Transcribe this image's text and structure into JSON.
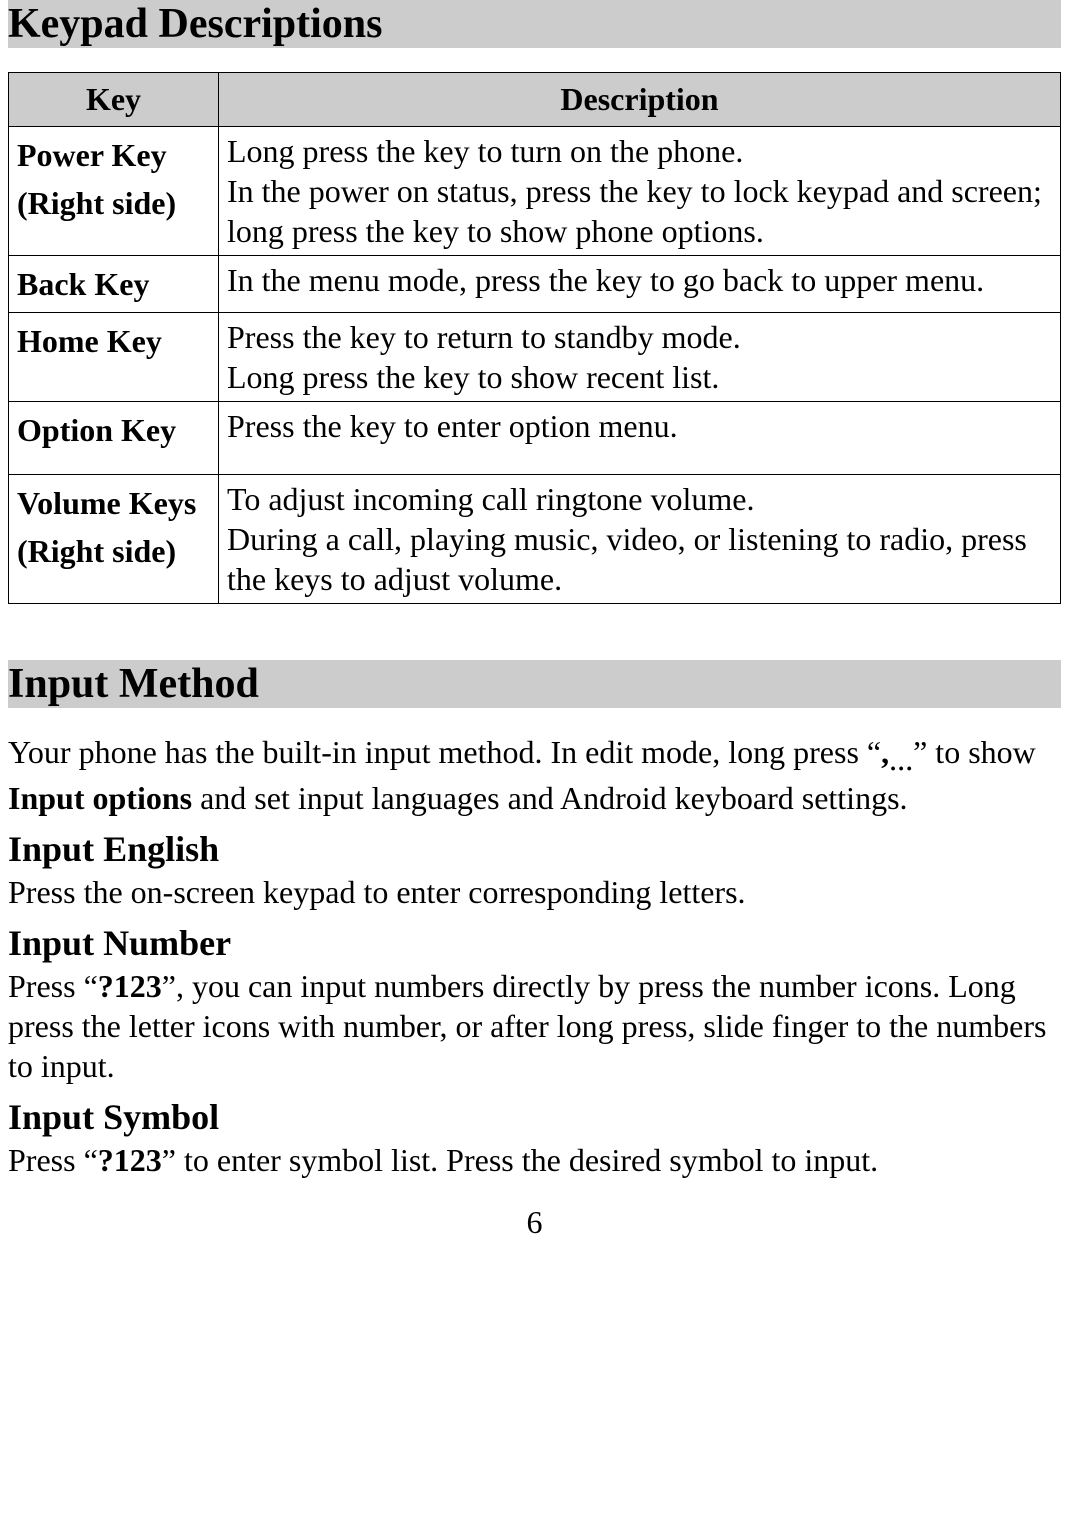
{
  "headings": {
    "keypad_descriptions": "Keypad Descriptions",
    "input_method": "Input Method",
    "input_english": "Input English",
    "input_number": "Input Number",
    "input_symbol": "Input Symbol"
  },
  "table": {
    "header_key": "Key",
    "header_description": "Description",
    "rows": [
      {
        "key": "Power Key (Right side)",
        "desc": "Long press the key to turn on the phone.\nIn the power on status, press the key to lock keypad and screen; long press the key to show phone options."
      },
      {
        "key": "Back Key",
        "desc": "In the menu mode, press the key to go back to upper menu."
      },
      {
        "key": "Home Key",
        "desc": "Press the key to return to standby mode.\nLong press the key to show recent list."
      },
      {
        "key": "Option Key",
        "desc": "Press the key to enter option menu."
      },
      {
        "key": "Volume Keys (Right side)",
        "desc": "To adjust incoming call ringtone volume.\nDuring a call, playing music, video, or listening to radio, press the keys to adjust volume."
      }
    ]
  },
  "paragraphs": {
    "input_method_intro_pre": "Your phone has the built-in input method. In edit mode, long press “",
    "input_method_intro_bold1": ",",
    "input_method_intro_sub": "…",
    "input_method_intro_mid": "” to show ",
    "input_method_intro_bold2": "Input options",
    "input_method_intro_post": " and set input languages and Android keyboard settings.",
    "input_english": "Press the on-screen keypad to enter corresponding letters.",
    "input_number_pre": "Press “",
    "input_number_bold": "?123",
    "input_number_post": "”, you can input numbers directly by press the number icons. Long press the letter icons with number, or after long press, slide finger to the numbers to input.",
    "input_symbol_pre": "Press “",
    "input_symbol_bold": "?123",
    "input_symbol_post": "” to enter symbol list. Press the desired symbol to input."
  },
  "page_number": "6"
}
